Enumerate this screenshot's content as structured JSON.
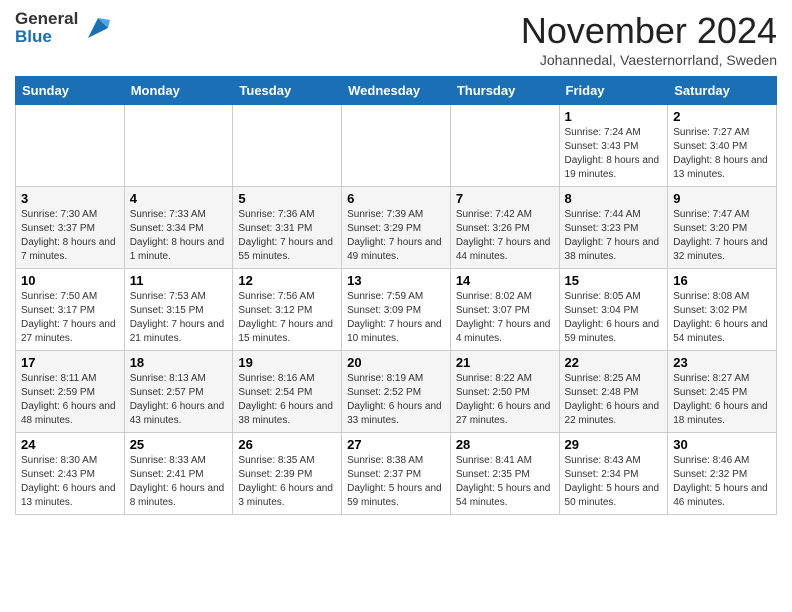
{
  "header": {
    "logo_general": "General",
    "logo_blue": "Blue",
    "month_title": "November 2024",
    "location": "Johannedal, Vaesternorrland, Sweden"
  },
  "weekdays": [
    "Sunday",
    "Monday",
    "Tuesday",
    "Wednesday",
    "Thursday",
    "Friday",
    "Saturday"
  ],
  "weeks": [
    [
      {
        "day": "",
        "info": ""
      },
      {
        "day": "",
        "info": ""
      },
      {
        "day": "",
        "info": ""
      },
      {
        "day": "",
        "info": ""
      },
      {
        "day": "",
        "info": ""
      },
      {
        "day": "1",
        "info": "Sunrise: 7:24 AM\nSunset: 3:43 PM\nDaylight: 8 hours and 19 minutes."
      },
      {
        "day": "2",
        "info": "Sunrise: 7:27 AM\nSunset: 3:40 PM\nDaylight: 8 hours and 13 minutes."
      }
    ],
    [
      {
        "day": "3",
        "info": "Sunrise: 7:30 AM\nSunset: 3:37 PM\nDaylight: 8 hours and 7 minutes."
      },
      {
        "day": "4",
        "info": "Sunrise: 7:33 AM\nSunset: 3:34 PM\nDaylight: 8 hours and 1 minute."
      },
      {
        "day": "5",
        "info": "Sunrise: 7:36 AM\nSunset: 3:31 PM\nDaylight: 7 hours and 55 minutes."
      },
      {
        "day": "6",
        "info": "Sunrise: 7:39 AM\nSunset: 3:29 PM\nDaylight: 7 hours and 49 minutes."
      },
      {
        "day": "7",
        "info": "Sunrise: 7:42 AM\nSunset: 3:26 PM\nDaylight: 7 hours and 44 minutes."
      },
      {
        "day": "8",
        "info": "Sunrise: 7:44 AM\nSunset: 3:23 PM\nDaylight: 7 hours and 38 minutes."
      },
      {
        "day": "9",
        "info": "Sunrise: 7:47 AM\nSunset: 3:20 PM\nDaylight: 7 hours and 32 minutes."
      }
    ],
    [
      {
        "day": "10",
        "info": "Sunrise: 7:50 AM\nSunset: 3:17 PM\nDaylight: 7 hours and 27 minutes."
      },
      {
        "day": "11",
        "info": "Sunrise: 7:53 AM\nSunset: 3:15 PM\nDaylight: 7 hours and 21 minutes."
      },
      {
        "day": "12",
        "info": "Sunrise: 7:56 AM\nSunset: 3:12 PM\nDaylight: 7 hours and 15 minutes."
      },
      {
        "day": "13",
        "info": "Sunrise: 7:59 AM\nSunset: 3:09 PM\nDaylight: 7 hours and 10 minutes."
      },
      {
        "day": "14",
        "info": "Sunrise: 8:02 AM\nSunset: 3:07 PM\nDaylight: 7 hours and 4 minutes."
      },
      {
        "day": "15",
        "info": "Sunrise: 8:05 AM\nSunset: 3:04 PM\nDaylight: 6 hours and 59 minutes."
      },
      {
        "day": "16",
        "info": "Sunrise: 8:08 AM\nSunset: 3:02 PM\nDaylight: 6 hours and 54 minutes."
      }
    ],
    [
      {
        "day": "17",
        "info": "Sunrise: 8:11 AM\nSunset: 2:59 PM\nDaylight: 6 hours and 48 minutes."
      },
      {
        "day": "18",
        "info": "Sunrise: 8:13 AM\nSunset: 2:57 PM\nDaylight: 6 hours and 43 minutes."
      },
      {
        "day": "19",
        "info": "Sunrise: 8:16 AM\nSunset: 2:54 PM\nDaylight: 6 hours and 38 minutes."
      },
      {
        "day": "20",
        "info": "Sunrise: 8:19 AM\nSunset: 2:52 PM\nDaylight: 6 hours and 33 minutes."
      },
      {
        "day": "21",
        "info": "Sunrise: 8:22 AM\nSunset: 2:50 PM\nDaylight: 6 hours and 27 minutes."
      },
      {
        "day": "22",
        "info": "Sunrise: 8:25 AM\nSunset: 2:48 PM\nDaylight: 6 hours and 22 minutes."
      },
      {
        "day": "23",
        "info": "Sunrise: 8:27 AM\nSunset: 2:45 PM\nDaylight: 6 hours and 18 minutes."
      }
    ],
    [
      {
        "day": "24",
        "info": "Sunrise: 8:30 AM\nSunset: 2:43 PM\nDaylight: 6 hours and 13 minutes."
      },
      {
        "day": "25",
        "info": "Sunrise: 8:33 AM\nSunset: 2:41 PM\nDaylight: 6 hours and 8 minutes."
      },
      {
        "day": "26",
        "info": "Sunrise: 8:35 AM\nSunset: 2:39 PM\nDaylight: 6 hours and 3 minutes."
      },
      {
        "day": "27",
        "info": "Sunrise: 8:38 AM\nSunset: 2:37 PM\nDaylight: 5 hours and 59 minutes."
      },
      {
        "day": "28",
        "info": "Sunrise: 8:41 AM\nSunset: 2:35 PM\nDaylight: 5 hours and 54 minutes."
      },
      {
        "day": "29",
        "info": "Sunrise: 8:43 AM\nSunset: 2:34 PM\nDaylight: 5 hours and 50 minutes."
      },
      {
        "day": "30",
        "info": "Sunrise: 8:46 AM\nSunset: 2:32 PM\nDaylight: 5 hours and 46 minutes."
      }
    ]
  ]
}
